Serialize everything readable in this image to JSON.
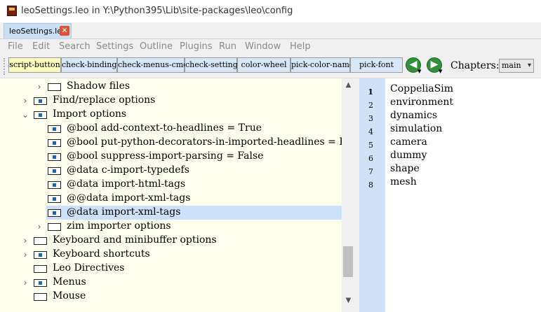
{
  "window": {
    "title": "leoSettings.leo in Y:\\Python395\\Lib\\site-packages\\leo\\config"
  },
  "tabs": [
    {
      "label": "leoSettings.leo",
      "close": "✕"
    }
  ],
  "menu": [
    "File",
    "Edit",
    "Search",
    "Settings",
    "Outline",
    "Plugins",
    "Run",
    "Window",
    "Help"
  ],
  "toolbar": {
    "buttons": [
      "script-button",
      "check-bindings",
      "check-menus-cmds",
      "check-settings",
      "color-wheel",
      "pick-color-name",
      "pick-font"
    ],
    "chapters_label": "Chapters:",
    "chapter_selected": "main"
  },
  "outline": [
    {
      "label": "Shadow files",
      "expander": "collapsed",
      "marked": false
    },
    {
      "label": "Find/replace options",
      "expander": "collapsed",
      "marked": true
    },
    {
      "label": "Import options",
      "expander": "expanded",
      "marked": true
    },
    {
      "label": "@bool add-context-to-headlines = True",
      "expander": "none",
      "marked": true
    },
    {
      "label": "@bool put-python-decorators-in-imported-headlines = False",
      "expander": "none",
      "marked": true
    },
    {
      "label": "@bool suppress-import-parsing = False",
      "expander": "none",
      "marked": true
    },
    {
      "label": "@data c-import-typedefs",
      "expander": "none",
      "marked": true
    },
    {
      "label": "@data import-html-tags",
      "expander": "none",
      "marked": true
    },
    {
      "label": "@@data import-xml-tags",
      "expander": "none",
      "marked": true
    },
    {
      "label": "@data import-xml-tags",
      "expander": "none",
      "marked": true,
      "selected": true
    },
    {
      "label": "zim importer options",
      "expander": "collapsed",
      "marked": false
    },
    {
      "label": "Keyboard and minibuffer options",
      "expander": "collapsed",
      "marked": false
    },
    {
      "label": "Keyboard shortcuts",
      "expander": "collapsed",
      "marked": true
    },
    {
      "label": "Leo Directives",
      "expander": "none",
      "marked": false
    },
    {
      "label": "Menus",
      "expander": "collapsed",
      "marked": true
    },
    {
      "label": "Mouse",
      "expander": "none",
      "marked": false
    }
  ],
  "body": {
    "lines": [
      "CoppeliaSim",
      "environment",
      "dynamics",
      "simulation",
      "camera",
      "dummy",
      "shape",
      "mesh"
    ],
    "line_numbers": [
      "1",
      "2",
      "3",
      "4",
      "5",
      "6",
      "7",
      "8"
    ],
    "current_line": 1
  },
  "colors": {
    "outline_bg": "#fffff0",
    "selected_row": "#cce0f7",
    "gutter": "#cfe2f8",
    "toolbar_button": "#d7e7f7",
    "active_toolbar_button": "#fbfbc0",
    "mark": "#1565c0"
  },
  "icons": {
    "back": "green-left-arrow-icon",
    "forward": "green-right-arrow-icon",
    "app": "leo-app-icon"
  }
}
